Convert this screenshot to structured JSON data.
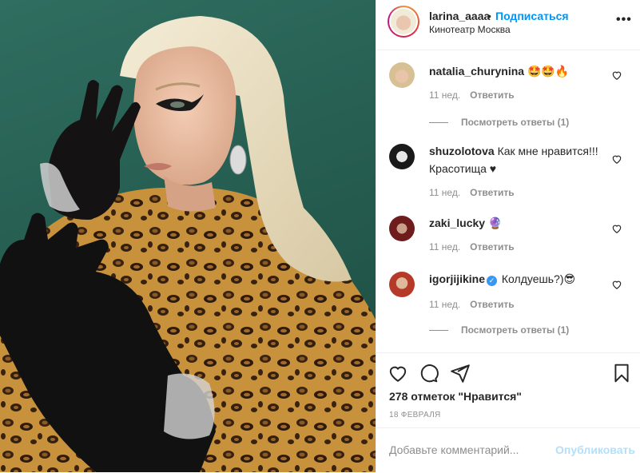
{
  "header": {
    "username": "larina_aaaa",
    "separator": "•",
    "follow_label": "Подписаться",
    "location": "Кинотеатр Москва",
    "more_label": "•••"
  },
  "comments": [
    {
      "username": "natalia_churynina",
      "text": "🤩🤩🔥",
      "verified": false,
      "time": "11 нед.",
      "reply": "Ответить",
      "view_replies": "Посмотреть ответы (1)"
    },
    {
      "username": "shuzolotova",
      "text": "Как мне нравится!!! Красотища ♥",
      "verified": false,
      "time": "11 нед.",
      "reply": "Ответить"
    },
    {
      "username": "zaki_lucky",
      "text": "🔮",
      "verified": false,
      "time": "11 нед.",
      "reply": "Ответить"
    },
    {
      "username": "igorjijikine",
      "text": "Колдуешь?)😎",
      "verified": true,
      "time": "11 нед.",
      "reply": "Ответить",
      "view_replies": "Посмотреть ответы (1)"
    }
  ],
  "actions": {
    "icons": [
      "heart-icon",
      "comment-icon",
      "share-icon",
      "bookmark-icon"
    ],
    "likes": "278 отметок \"Нравится\"",
    "date": "18 ФЕВРАЛЯ"
  },
  "add_comment": {
    "placeholder": "Добавьте комментарий...",
    "publish_label": "Опубликовать"
  },
  "colors": {
    "link_blue": "#0095f6",
    "publish_disabled": "#b2dffc",
    "muted": "#8e8e8e",
    "photo_bg": "#2a6457"
  }
}
